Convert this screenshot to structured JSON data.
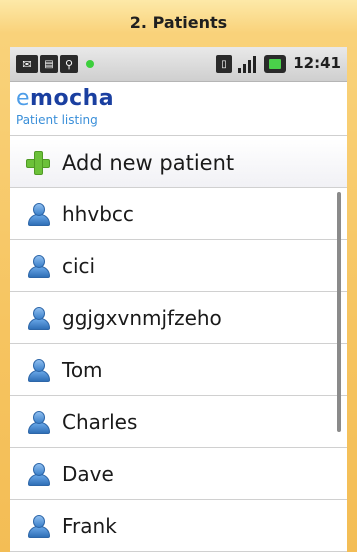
{
  "window": {
    "title": "2. Patients"
  },
  "statusbar": {
    "time": "12:41",
    "icons": [
      "mail-icon",
      "document-icon",
      "usb-icon",
      "notification-dot-icon",
      "vibrate-icon",
      "signal-icon",
      "battery-icon"
    ]
  },
  "app": {
    "brand_prefix": "e",
    "brand_name": "mocha",
    "subtitle": "Patient listing"
  },
  "actions": {
    "add_label": "Add new patient"
  },
  "patients": [
    {
      "name": "hhvbcc"
    },
    {
      "name": "cici"
    },
    {
      "name": "ggjgxvnmjfzeho"
    },
    {
      "name": "Tom"
    },
    {
      "name": "Charles"
    },
    {
      "name": "Dave"
    },
    {
      "name": "Frank"
    }
  ],
  "colors": {
    "brand": "#1a3fa0",
    "brand_accent": "#4d9de8",
    "subtitle": "#3a8fd9",
    "frame": "#f6c460"
  }
}
